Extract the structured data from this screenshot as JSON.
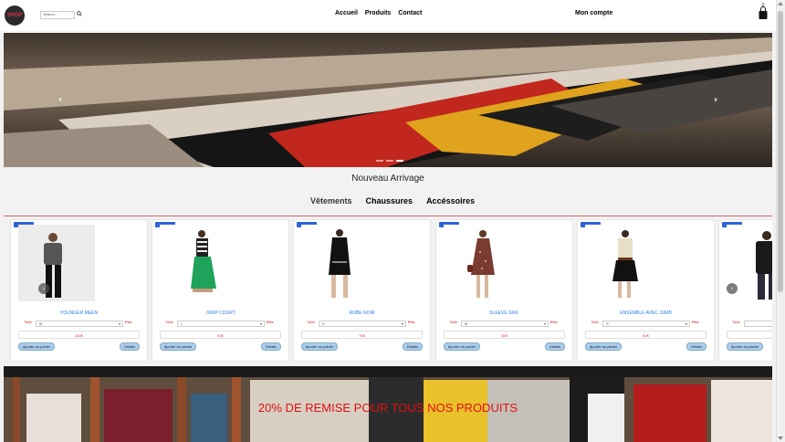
{
  "header": {
    "logo_text": "SHOP",
    "search_placeholder": "Search...",
    "nav": [
      "Accueil",
      "Produits",
      "Contact"
    ],
    "account": "Mon compte",
    "cart_count": "0"
  },
  "hero": {
    "active_slide": 3,
    "slide_count": 3
  },
  "section_title": "Nouveau Arrivage",
  "categories": [
    "Vêtements",
    "Chaussures",
    "Accéssoires"
  ],
  "products": [
    {
      "name": "YOUNGER MEEN",
      "size": "M",
      "price": "150€"
    },
    {
      "name": "JUMP COURT",
      "size": "L",
      "price": "50€"
    },
    {
      "name": "ROBE NOIR",
      "size": "S",
      "price": "75€"
    },
    {
      "name": "SLEEVE GIRL",
      "size": "M",
      "price": "35€"
    },
    {
      "name": "ENSEMBLE AVEC JUMB",
      "size": "S",
      "price": "60€"
    },
    {
      "name": "",
      "size": "",
      "price": ""
    }
  ],
  "product_labels": {
    "size_label": "Taille",
    "price_label": "Prix",
    "add_to_cart": "Ajouter au panier",
    "details": "Détails"
  },
  "promo_text": "20% DE REMISE POUR TOUS NOS PRODUITS",
  "colors": {
    "accent_blue": "#2e64d8",
    "price_red": "#d33333",
    "promo_red": "#e01010",
    "link_blue": "#2b7de9"
  }
}
